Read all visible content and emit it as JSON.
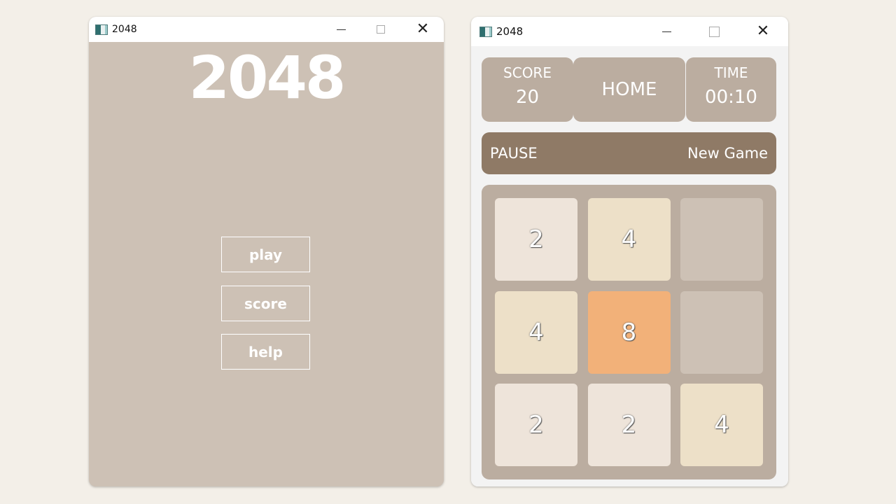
{
  "left_window": {
    "title": "2048",
    "logo": "2048",
    "buttons": {
      "play": "play",
      "score": "score",
      "help": "help"
    }
  },
  "right_window": {
    "title": "2048",
    "score": {
      "label": "SCORE",
      "value": "20"
    },
    "home": "HOME",
    "time": {
      "label": "TIME",
      "value": "00:10"
    },
    "pause": "PAUSE",
    "new_game": "New Game",
    "board": [
      [
        "2",
        "4",
        ""
      ],
      [
        "4",
        "8",
        ""
      ],
      [
        "2",
        "2",
        "4"
      ]
    ]
  },
  "colors": {
    "menu_bg": "#cdc1b5",
    "panel": "#bbada0",
    "action_bar": "#8f7a66",
    "tile_empty": "#cdc1b5",
    "tile_2": "#eee4da",
    "tile_4": "#ede0c8",
    "tile_8": "#f2b179"
  },
  "icons": [
    "app-icon",
    "minimize-icon",
    "maximize-icon",
    "close-icon"
  ]
}
